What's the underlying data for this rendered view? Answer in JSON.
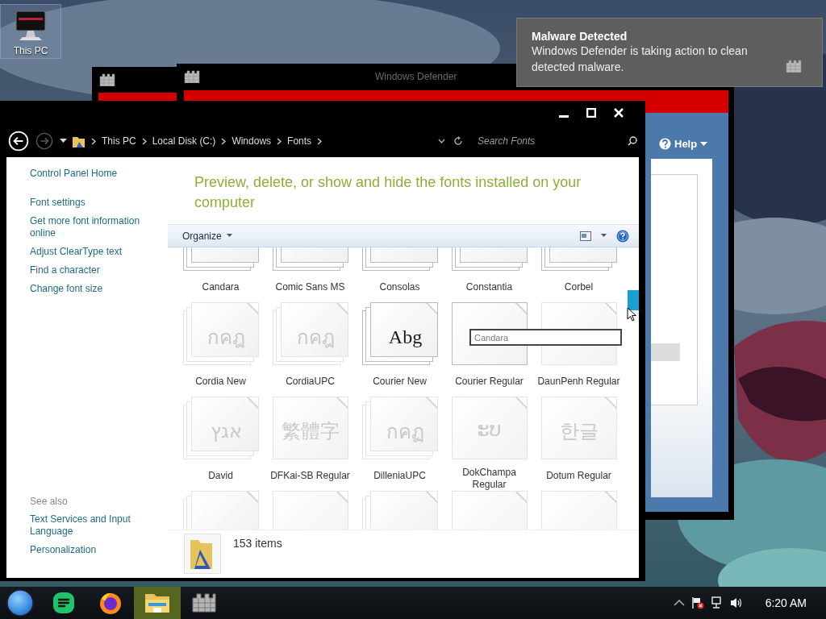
{
  "desktop": {
    "icons": [
      {
        "label": "This PC",
        "selected": true
      }
    ]
  },
  "defender_windows": [
    {
      "kind": "compact"
    },
    {
      "kind": "main",
      "title": "Windows Defender",
      "help": "Help"
    }
  ],
  "explorer": {
    "nav": [
      {
        "kind": "back",
        "disabled": false
      },
      {
        "kind": "forward",
        "disabled": true
      }
    ],
    "breadcrumb": [
      "This PC",
      "Local Disk (C:)",
      "Windows",
      "Fonts"
    ],
    "search": {
      "placeholder": "Search Fonts"
    },
    "sidebar": {
      "tasks": [
        "Control Panel Home",
        "Font settings",
        "Get more font information online",
        "Adjust ClearType text",
        "Find a character",
        "Change font size"
      ],
      "see_also_heading": "See also",
      "see_also": [
        "Text Services and Input Language",
        "Personalization"
      ]
    },
    "heading": "Preview, delete, or show and hide the fonts installed on your computer",
    "toolbar": {
      "organize": "Organize"
    },
    "fonts": [
      {
        "name": "Candara",
        "family": true,
        "dimmed": false
      },
      {
        "name": "Comic Sans MS",
        "family": true,
        "dimmed": false
      },
      {
        "name": "Consolas",
        "family": true,
        "dimmed": false
      },
      {
        "name": "Constantia",
        "family": true,
        "dimmed": false
      },
      {
        "name": "Corbel",
        "family": true,
        "dimmed": false
      },
      {
        "name": "Cordia New",
        "preview": "กคฎ",
        "family": true,
        "dimmed": true
      },
      {
        "name": "CordiaUPC",
        "preview": "กคฎ",
        "family": true,
        "dimmed": true
      },
      {
        "name": "Courier New",
        "preview": "Abg",
        "family": true,
        "dimmed": false
      },
      {
        "name": "Courier Regular",
        "family": false,
        "dimmed": false
      },
      {
        "name": "DaunPenh Regular",
        "family": false,
        "dimmed": true
      },
      {
        "name": "David",
        "preview": "אגץ",
        "family": true,
        "dimmed": true
      },
      {
        "name": "DFKai-SB Regular",
        "preview": "繁體字",
        "family": false,
        "dimmed": true
      },
      {
        "name": "DilleniaUPC",
        "preview": "กคฏ",
        "family": true,
        "dimmed": true
      },
      {
        "name": "DokChampa Regular",
        "preview": "ະບ",
        "family": false,
        "dimmed": true
      },
      {
        "name": "Dotum Regular",
        "preview": "한글",
        "family": false,
        "dimmed": true
      },
      {
        "family": true,
        "dimmed": true
      },
      {
        "family": false,
        "dimmed": true
      },
      {
        "family": true,
        "dimmed": true
      },
      {
        "family": false,
        "dimmed": true
      },
      {
        "family": false,
        "dimmed": true
      }
    ],
    "rename_field": {
      "value": "Candara"
    },
    "status": {
      "count": "153 items"
    }
  },
  "notification": {
    "title": "Malware Detected",
    "message": "Windows Defender is taking action to clean detected malware."
  },
  "taskbar": {
    "apps": [
      {
        "kind": "start",
        "selected": false
      },
      {
        "kind": "notes",
        "selected": false
      },
      {
        "kind": "browser",
        "selected": false
      },
      {
        "kind": "explorer",
        "selected": true
      },
      {
        "kind": "defender",
        "selected": false
      }
    ],
    "tray": [
      {
        "kind": "chevron"
      },
      {
        "kind": "flag"
      },
      {
        "kind": "network"
      },
      {
        "kind": "volume"
      }
    ],
    "clock": "6:20 AM"
  }
}
